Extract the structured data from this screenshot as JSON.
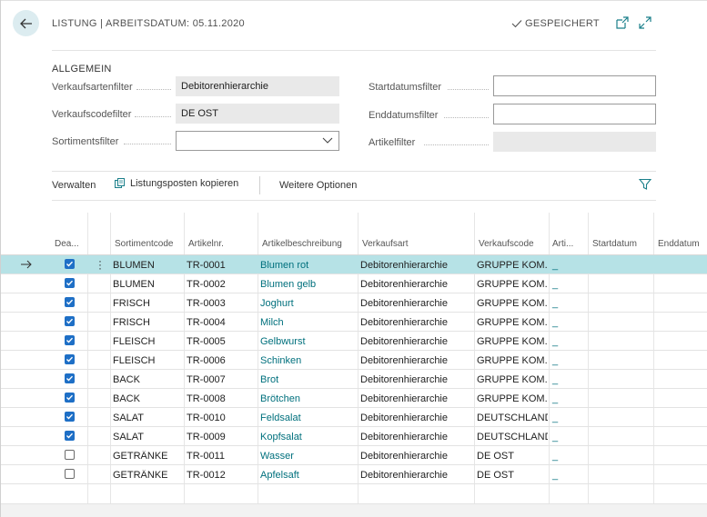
{
  "header": {
    "title": "LISTUNG | ARBEITSDATUM: 05.11.2020",
    "saved_label": "GESPEICHERT"
  },
  "general": {
    "section_title": "ALLGEMEIN",
    "fields_left": [
      {
        "label": "Verkaufsartenfilter",
        "value": "Debitorenhierarchie"
      },
      {
        "label": "Verkaufscodefilter",
        "value": "DE OST"
      },
      {
        "label": "Sortimentsfilter",
        "value": ""
      }
    ],
    "fields_right": [
      {
        "label": "Startdatumsfilter",
        "value": ""
      },
      {
        "label": "Enddatumsfilter",
        "value": ""
      },
      {
        "label": "Artikelfilter",
        "value": ""
      }
    ]
  },
  "actions": {
    "manage": "Verwalten",
    "copy": "Listungsposten kopieren",
    "more": "Weitere Optionen"
  },
  "table": {
    "headers": [
      "Dea...",
      "Sortimentcode",
      "Artikelnr.",
      "Artikelbeschreibung",
      "Verkaufsart",
      "Verkaufscode",
      "Arti...",
      "Startdatum",
      "Enddatum"
    ],
    "rows": [
      {
        "checked": true,
        "sortiment": "BLUMEN",
        "nr": "TR-0001",
        "desc": "Blumen rot",
        "art": "Debitorenhierarchie",
        "code": "GRUPPE KOM...",
        "arti": "_"
      },
      {
        "checked": true,
        "sortiment": "BLUMEN",
        "nr": "TR-0002",
        "desc": "Blumen gelb",
        "art": "Debitorenhierarchie",
        "code": "GRUPPE KOM...",
        "arti": "_"
      },
      {
        "checked": true,
        "sortiment": "FRISCH",
        "nr": "TR-0003",
        "desc": "Joghurt",
        "art": "Debitorenhierarchie",
        "code": "GRUPPE KOM...",
        "arti": "_"
      },
      {
        "checked": true,
        "sortiment": "FRISCH",
        "nr": "TR-0004",
        "desc": "Milch",
        "art": "Debitorenhierarchie",
        "code": "GRUPPE KOM...",
        "arti": "_"
      },
      {
        "checked": true,
        "sortiment": "FLEISCH",
        "nr": "TR-0005",
        "desc": "Gelbwurst",
        "art": "Debitorenhierarchie",
        "code": "GRUPPE KOM...",
        "arti": "_"
      },
      {
        "checked": true,
        "sortiment": "FLEISCH",
        "nr": "TR-0006",
        "desc": "Schinken",
        "art": "Debitorenhierarchie",
        "code": "GRUPPE KOM...",
        "arti": "_"
      },
      {
        "checked": true,
        "sortiment": "BACK",
        "nr": "TR-0007",
        "desc": "Brot",
        "art": "Debitorenhierarchie",
        "code": "GRUPPE KOM...",
        "arti": "_"
      },
      {
        "checked": true,
        "sortiment": "BACK",
        "nr": "TR-0008",
        "desc": "Brötchen",
        "art": "Debitorenhierarchie",
        "code": "GRUPPE KOM...",
        "arti": "_"
      },
      {
        "checked": true,
        "sortiment": "SALAT",
        "nr": "TR-0010",
        "desc": "Feldsalat",
        "art": "Debitorenhierarchie",
        "code": "DEUTSCHLAND",
        "arti": "_"
      },
      {
        "checked": true,
        "sortiment": "SALAT",
        "nr": "TR-0009",
        "desc": "Kopfsalat",
        "art": "Debitorenhierarchie",
        "code": "DEUTSCHLAND",
        "arti": "_"
      },
      {
        "checked": false,
        "sortiment": "GETRÄNKE",
        "nr": "TR-0011",
        "desc": "Wasser",
        "art": "Debitorenhierarchie",
        "code": "DE OST",
        "arti": "_"
      },
      {
        "checked": false,
        "sortiment": "GETRÄNKE",
        "nr": "TR-0012",
        "desc": "Apfelsaft",
        "art": "Debitorenhierarchie",
        "code": "DE OST",
        "arti": "_"
      }
    ]
  },
  "colors": {
    "accent": "#00707d",
    "selected_row": "#b6e2e6",
    "checkbox": "#1e6fc6"
  }
}
